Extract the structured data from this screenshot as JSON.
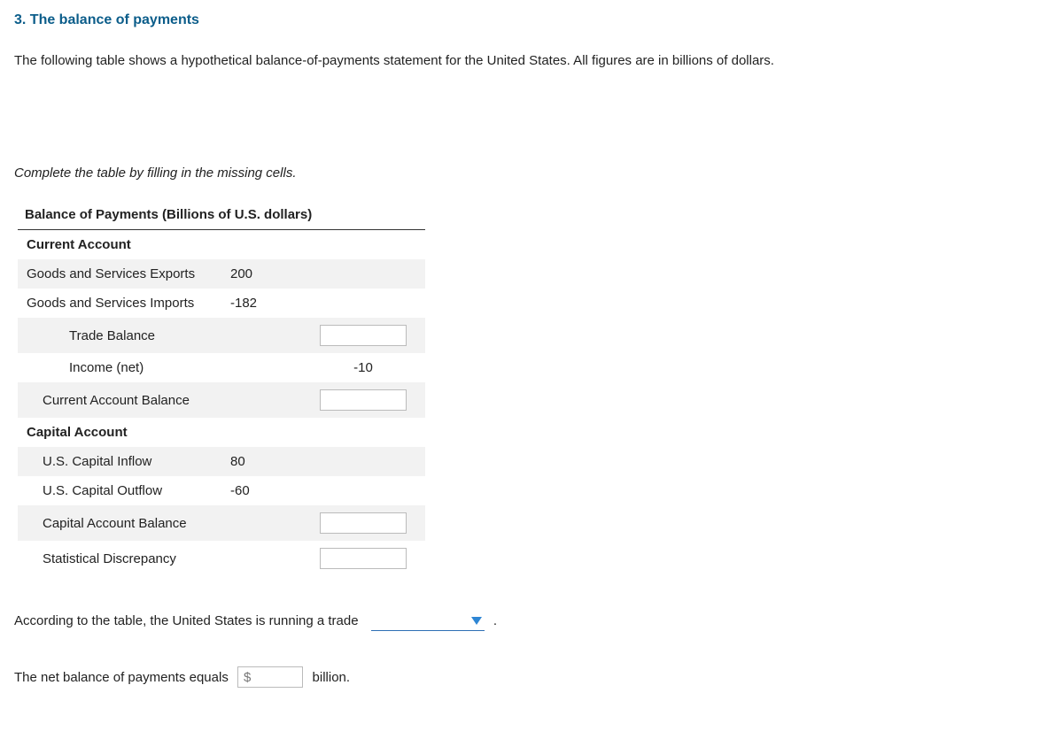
{
  "title": "3. The balance of payments",
  "intro": "The following table shows a hypothetical balance-of-payments statement for the United States. All figures are in billions of dollars.",
  "instruction": "Complete the table by filling in the missing cells.",
  "table": {
    "header": "Balance of Payments (Billions of U.S. dollars)",
    "current_account_label": "Current Account",
    "goods_exports_label": "Goods and Services Exports",
    "goods_exports_value": "200",
    "goods_imports_label": "Goods and Services Imports",
    "goods_imports_value": "-182",
    "trade_balance_label": "Trade Balance",
    "income_net_label": "Income (net)",
    "income_net_value": "-10",
    "current_balance_label": "Current Account Balance",
    "capital_account_label": "Capital Account",
    "capital_inflow_label": "U.S. Capital Inflow",
    "capital_inflow_value": "80",
    "capital_outflow_label": "U.S. Capital Outflow",
    "capital_outflow_value": "-60",
    "capital_balance_label": "Capital Account Balance",
    "stat_discrepancy_label": "Statistical Discrepancy"
  },
  "q1_prefix": "According to the table, the United States is running a trade",
  "q1_period": ".",
  "q2_prefix": "The net balance of payments equals",
  "q2_dollar": "$",
  "q2_suffix": "billion."
}
